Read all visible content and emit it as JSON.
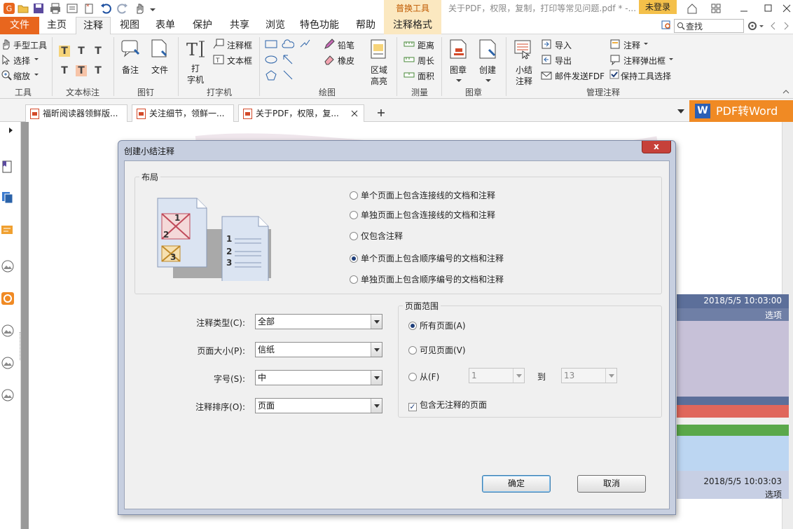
{
  "titlebar": {
    "context_tab": "普换工具",
    "document_title": "关于PDF，权限，复制，打印等常见问题.pdf * -...",
    "login": "未登录"
  },
  "menu": {
    "tabs": [
      "文件",
      "主页",
      "注释",
      "视图",
      "表单",
      "保护",
      "共享",
      "浏览",
      "特色功能",
      "帮助",
      "注释格式"
    ],
    "active": "注释"
  },
  "search": {
    "value": "查找"
  },
  "ribbon": {
    "tools": {
      "hand": "手型工具",
      "select": "选择",
      "zoom": "缩放",
      "label": "工具"
    },
    "text_markup": {
      "label": "文本标注"
    },
    "pin": {
      "note": "备注",
      "file": "文件",
      "label": "图钉"
    },
    "typewriter": {
      "typewriter_line1": "打",
      "typewriter_line2": "字机",
      "callout": "注释框",
      "textbox": "文本框",
      "label": "打字机"
    },
    "drawing": {
      "pencil": "铅笔",
      "eraser": "橡皮",
      "label": "绘图"
    },
    "area_highlight": {
      "line1": "区域",
      "line2": "高亮"
    },
    "measure": {
      "distance": "距离",
      "perimeter": "周长",
      "area": "面积",
      "label": "测量"
    },
    "stamp": {
      "stamp": "图章",
      "create": "创建",
      "label": "图章"
    },
    "manage": {
      "summarize_line1": "小结",
      "summarize_line2": "注释",
      "import": "导入",
      "export": "导出",
      "email_fdf": "邮件发送FDF",
      "comments": "注释",
      "popup": "注释弹出框",
      "keep_tool": "保持工具选择",
      "label": "管理注释"
    }
  },
  "doc_tabs": [
    "福昕阅读器领鲜版...",
    "关注细节，领鲜一...",
    "关于PDF，权限，复..."
  ],
  "pdf_to_word": "PDF转Word",
  "comments_panel": {
    "time1": "2018/5/5 10:03:00",
    "options1": "选项",
    "time2": "2018/5/5 10:03:03",
    "options2": "选项"
  },
  "dialog": {
    "title": "创建小结注释",
    "close": "x",
    "layout_group": "布局",
    "layout_options": [
      "单个页面上包含连接线的文档和注释",
      "单独页面上包含连接线的文档和注释",
      "仅包含注释",
      "单个页面上包含顺序编号的文档和注释",
      "单独页面上包含顺序编号的文档和注释"
    ],
    "layout_selected": 3,
    "illustration_numbers": [
      "1",
      "2",
      "3",
      "1",
      "2",
      "3"
    ],
    "fields": {
      "annot_type_label": "注释类型(C):",
      "annot_type_value": "全部",
      "page_size_label": "页面大小(P):",
      "page_size_value": "信纸",
      "font_size_label": "字号(S):",
      "font_size_value": "中",
      "sort_label": "注释排序(O):",
      "sort_value": "页面"
    },
    "page_range": {
      "group": "页面范围",
      "all": "所有页面(A)",
      "visible": "可见页面(V)",
      "from": "从(F)",
      "from_value": "1",
      "to": "到",
      "to_value": "13",
      "include_empty": "包含无注释的页面",
      "selected": "all",
      "include_empty_checked": true
    },
    "ok": "确定",
    "cancel": "取消"
  },
  "colors": {
    "accent_orange": "#e8661e",
    "dialog_frame": "#c7cfe0",
    "note_blue": "#5c6f9a",
    "note_red": "#e0675c",
    "note_green": "#5aa84a",
    "note_lightblue": "#bcd6f2"
  }
}
